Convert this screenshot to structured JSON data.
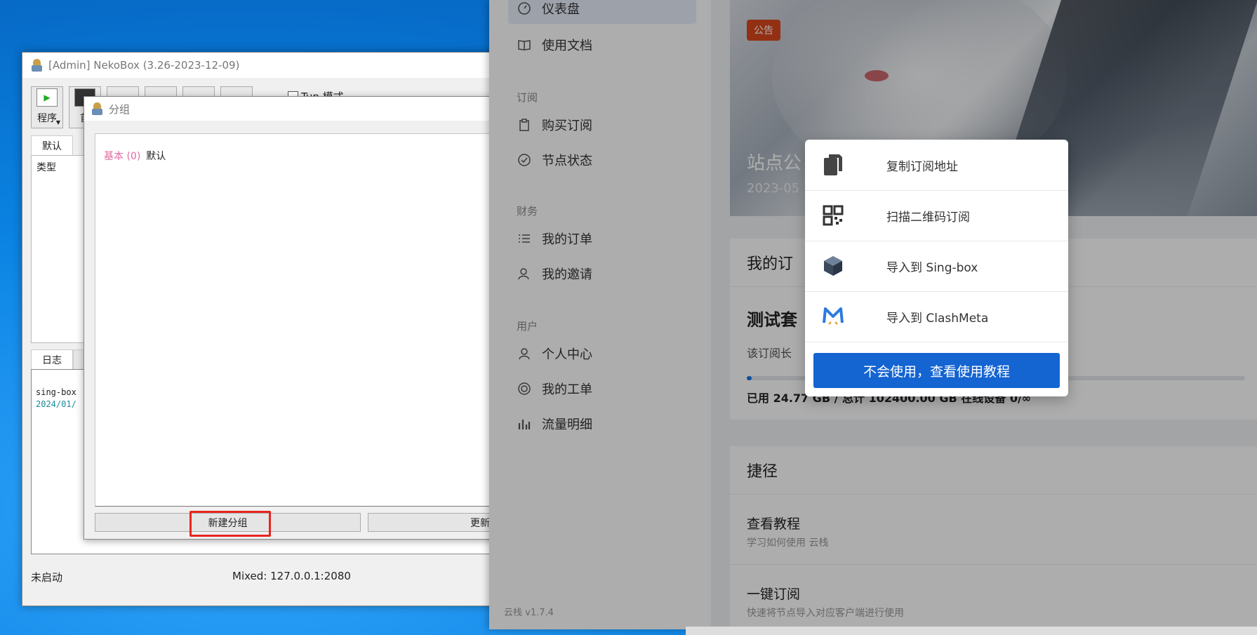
{
  "nekobox": {
    "title": "[Admin] NekoBox (3.26-2023-12-09)",
    "toolbar": {
      "program_label": "程序",
      "home_label": "首",
      "tun_label": "Tun 模式"
    },
    "tab_default": "默认",
    "list_col_type": "类型",
    "tab_log": "日志",
    "log": [
      "sing-box",
      "2024/01/"
    ],
    "status": "未启动",
    "mixed": "Mixed: 127.0.0.1:2080"
  },
  "group_dialog": {
    "title": "分组",
    "groups": [
      {
        "type": "基本 (0)",
        "name": "默认"
      }
    ],
    "new_button": "新建分组",
    "update_button": "更新"
  },
  "panel": {
    "sidebar": {
      "dashboard": "仪表盘",
      "docs": "使用文档",
      "section_subscribe": "订阅",
      "buy": "购买订阅",
      "node_status": "节点状态",
      "section_finance": "财务",
      "orders": "我的订单",
      "invites": "我的邀请",
      "section_user": "用户",
      "profile": "个人中心",
      "tickets": "我的工单",
      "traffic": "流量明细",
      "version": "云栈 v1.7.4"
    },
    "banner": {
      "badge": "公告",
      "title": "站点公",
      "date": "2023-05"
    },
    "subscription": {
      "header": "我的订",
      "plan": "测试套",
      "desc": "该订阅长",
      "usage": "已用 24.77 GB / 总计 102400.00 GB 在线设备 0/∞",
      "progress_fraction": 0.0002
    },
    "shortcuts": {
      "header": "捷径",
      "items": [
        {
          "title": "查看教程",
          "subtitle": "学习如何使用 云栈"
        },
        {
          "title": "一键订阅",
          "subtitle": "快速将节点导入对应客户端进行使用"
        }
      ]
    }
  },
  "popup": {
    "items": [
      {
        "label": "复制订阅地址",
        "icon": "copy-icon"
      },
      {
        "label": "扫描二维码订阅",
        "icon": "qrcode-icon"
      },
      {
        "label": "导入到 Sing-box",
        "icon": "singbox-icon"
      },
      {
        "label": "导入到 ClashMeta",
        "icon": "clashmeta-icon"
      }
    ],
    "cta": "不会使用，查看使用教程"
  },
  "colors": {
    "accent": "#1464d2",
    "highlight": "#e8251f",
    "badge": "#d9481c",
    "group_type": "#e26aa0"
  }
}
